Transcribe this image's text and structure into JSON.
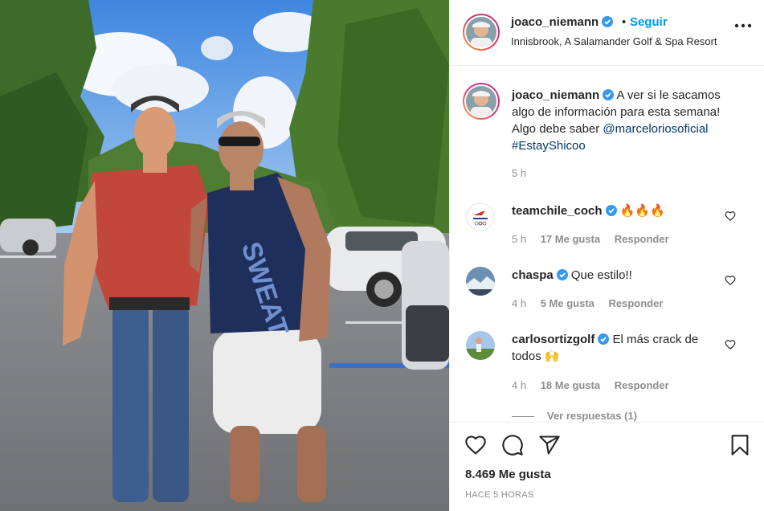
{
  "header": {
    "username": "joaco_niemann",
    "dot": "•",
    "follow_label": "Seguir",
    "location": "Innisbrook, A Salamander Golf & Spa Resort"
  },
  "caption": {
    "username": "joaco_niemann",
    "text": "A ver si le sacamos algo de información para esta semana! Algo debe saber",
    "mention": "@marceloriosoficial",
    "hashtag": "#EstayShicoo",
    "time": "5 h"
  },
  "comments": [
    {
      "username": "teamchile_coch",
      "text": "🔥🔥🔥",
      "time": "5 h",
      "likes": "17 Me gusta",
      "reply": "Responder"
    },
    {
      "username": "chaspa",
      "text": "Que estilo!!",
      "time": "4 h",
      "likes": "5 Me gusta",
      "reply": "Responder"
    },
    {
      "username": "carlosortizgolf",
      "text": "El más crack de todos 🙌",
      "time": "4 h",
      "likes": "18 Me gusta",
      "reply": "Responder"
    }
  ],
  "replies_label": "Ver respuestas (1)",
  "footer": {
    "likes": "8.469 Me gusta",
    "post_time": "HACE 5 HORAS"
  },
  "icons": {
    "verified": "verified-badge-icon",
    "more": "more-options-icon",
    "heart": "heart-icon",
    "comment": "comment-icon",
    "share": "share-icon",
    "save": "bookmark-icon"
  },
  "colors": {
    "link_blue": "#0095f6",
    "mention_blue": "#00376b",
    "muted": "#8e8e8e",
    "verified": "#3897f0"
  }
}
